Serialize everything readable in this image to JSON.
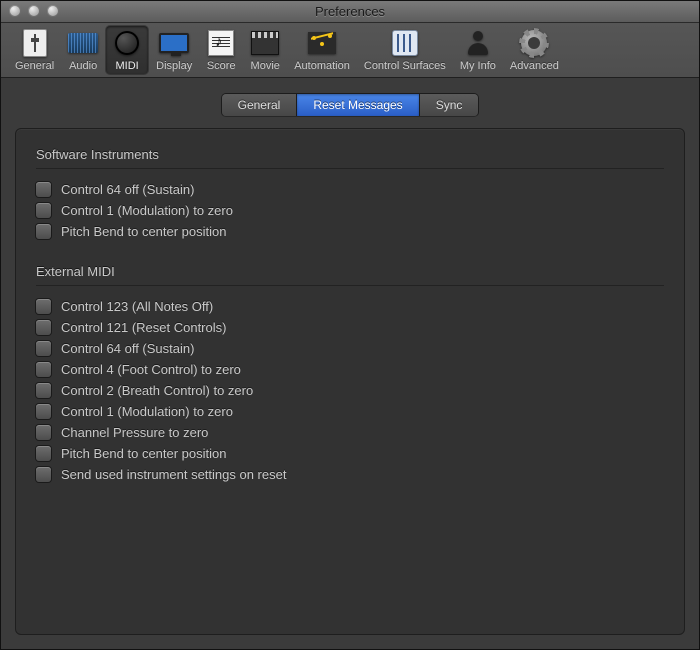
{
  "window": {
    "title": "Preferences"
  },
  "toolbar": {
    "items": [
      {
        "label": "General",
        "name": "toolbar-general",
        "icon": "slider-icon"
      },
      {
        "label": "Audio",
        "name": "toolbar-audio",
        "icon": "waveform-icon"
      },
      {
        "label": "MIDI",
        "name": "toolbar-midi",
        "icon": "midi-port-icon",
        "selected": true
      },
      {
        "label": "Display",
        "name": "toolbar-display",
        "icon": "monitor-icon"
      },
      {
        "label": "Score",
        "name": "toolbar-score",
        "icon": "score-icon"
      },
      {
        "label": "Movie",
        "name": "toolbar-movie",
        "icon": "clapper-icon"
      },
      {
        "label": "Automation",
        "name": "toolbar-automation",
        "icon": "automation-icon"
      },
      {
        "label": "Control Surfaces",
        "name": "toolbar-control-surfaces",
        "icon": "mixer-icon"
      },
      {
        "label": "My Info",
        "name": "toolbar-my-info",
        "icon": "person-icon"
      },
      {
        "label": "Advanced",
        "name": "toolbar-advanced",
        "icon": "gear-icon"
      }
    ]
  },
  "tabs": {
    "items": [
      {
        "label": "General",
        "name": "subtab-general",
        "active": false
      },
      {
        "label": "Reset Messages",
        "name": "subtab-reset-messages",
        "active": true
      },
      {
        "label": "Sync",
        "name": "subtab-sync",
        "active": false
      }
    ]
  },
  "sections": {
    "software": {
      "title": "Software Instruments",
      "items": [
        {
          "label": "Control 64 off (Sustain)",
          "name": "chk-si-control-64-off",
          "checked": false
        },
        {
          "label": "Control 1 (Modulation) to zero",
          "name": "chk-si-control-1-zero",
          "checked": false
        },
        {
          "label": "Pitch Bend to center position",
          "name": "chk-si-pitch-bend",
          "checked": false
        }
      ]
    },
    "external": {
      "title": "External MIDI",
      "items": [
        {
          "label": "Control 123 (All Notes Off)",
          "name": "chk-em-control-123",
          "checked": false
        },
        {
          "label": "Control 121 (Reset Controls)",
          "name": "chk-em-control-121",
          "checked": false
        },
        {
          "label": "Control 64 off (Sustain)",
          "name": "chk-em-control-64-off",
          "checked": false
        },
        {
          "label": "Control 4 (Foot Control) to zero",
          "name": "chk-em-control-4-zero",
          "checked": false
        },
        {
          "label": "Control 2 (Breath Control) to zero",
          "name": "chk-em-control-2-zero",
          "checked": false
        },
        {
          "label": "Control 1 (Modulation) to zero",
          "name": "chk-em-control-1-zero",
          "checked": false
        },
        {
          "label": "Channel Pressure to zero",
          "name": "chk-em-channel-pressure",
          "checked": false
        },
        {
          "label": "Pitch Bend to center position",
          "name": "chk-em-pitch-bend",
          "checked": false
        },
        {
          "label": "Send used instrument settings on reset",
          "name": "chk-em-send-settings",
          "checked": false
        }
      ]
    }
  }
}
